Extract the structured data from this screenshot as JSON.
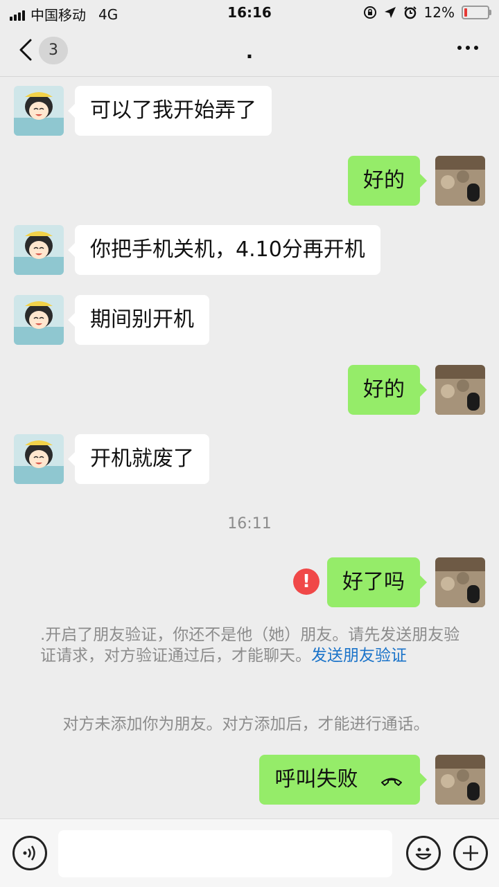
{
  "status_bar": {
    "carrier": "中国移动",
    "network": "4G",
    "time": "16:16",
    "battery_percent": "12%",
    "battery_level": 0.12
  },
  "nav": {
    "unread_count": "3",
    "title": "."
  },
  "messages": [
    {
      "side": "left",
      "text": "可以了我开始弄了"
    },
    {
      "side": "right",
      "text": "好的"
    },
    {
      "side": "left",
      "text": "你把手机关机，4.10分再开机"
    },
    {
      "side": "left",
      "text": "期间别开机"
    },
    {
      "side": "right",
      "text": "好的"
    },
    {
      "side": "left",
      "text": "开机就废了"
    },
    {
      "side": "right",
      "text": "好了吗",
      "failed": true
    },
    {
      "side": "right",
      "text": "呼叫失败",
      "call": true
    }
  ],
  "timestamp": "16:11",
  "error_mark": "!",
  "system_notice": {
    "text": ".开启了朋友验证，你还不是他（她）朋友。请先发送朋友验证请求，对方验证通过后，才能聊天。",
    "link": "发送朋友验证"
  },
  "system_notice_2": "对方未添加你为朋友。对方添加后，才能进行通话。",
  "icons": [
    "back-chevron-icon",
    "more-dots-icon",
    "voice-icon",
    "emoji-icon",
    "plus-icon",
    "hangup-icon",
    "error-icon"
  ],
  "colors": {
    "sent_bubble": "#95ec69",
    "received_bubble": "#ffffff",
    "background": "#ededed",
    "link": "#1a73c9",
    "error": "#f04848"
  }
}
